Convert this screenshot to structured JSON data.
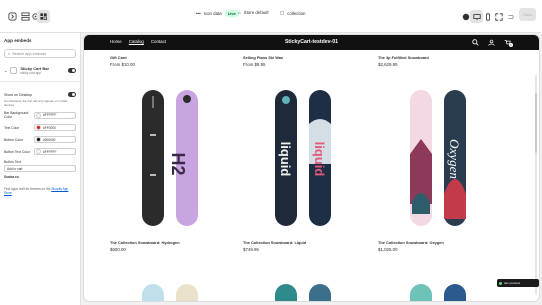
{
  "toolbar": {
    "theme_name": "Icon data",
    "live_label": "Live",
    "page_template": "Store default",
    "collection_label": "collection",
    "save_label": "Save"
  },
  "sidebar": {
    "title": "App embeds",
    "search_placeholder": "Search app embeds",
    "app": {
      "name": "Sticky Cart Bar",
      "subtitle": "sticky-cart-app"
    },
    "show_on_desktop_label": "Show on Desktop",
    "note": "If unchecked, the bar will only appear on mobile devices.",
    "fields": [
      {
        "label": "Bar Background Color",
        "value": "#FFFFFF",
        "color": "#ffffff"
      },
      {
        "label": "Text Color",
        "value": "#FF0000",
        "color": "#e21b1b"
      },
      {
        "label": "Button Color",
        "value": "#000000",
        "color": "#000000"
      },
      {
        "label": "Button Text Color",
        "value": "#FFFFFF",
        "color": "#ffffff"
      }
    ],
    "button_text_label": "Button Text",
    "button_text_value": "Add to cart",
    "preview_value": "Guoba.eu",
    "footer_text": "Find apps built for themes on the ",
    "footer_link": "Shopify App Store"
  },
  "store": {
    "nav": [
      "Home",
      "Catalog",
      "Contact"
    ],
    "brand": "StickyCart-testdev-01",
    "cart_count": "1"
  },
  "products_top": [
    {
      "name": "Gift Card",
      "price": "From $10.00"
    },
    {
      "name": "Selling Plans Ski Wax",
      "price": "From $9.95"
    },
    {
      "name": "The 3p Fulfilled Snowboard",
      "price": "$2,629.95"
    }
  ],
  "products_mid": [
    {
      "name": "The Collection Snowboard: Hydrogen",
      "price": "$600.00",
      "art_text": "H2"
    },
    {
      "name": "The Collection Snowboard: Liquid",
      "price": "$749.95",
      "art_text": "liquid"
    },
    {
      "name": "The Collection Snowboard: Oxygen",
      "price": "$1,025.00",
      "art_text": "Oxygen"
    }
  ],
  "dev_badge": "dev preview",
  "colors": {
    "accent": "#005bd3",
    "header": "#111111",
    "live": "#cdfee1"
  }
}
